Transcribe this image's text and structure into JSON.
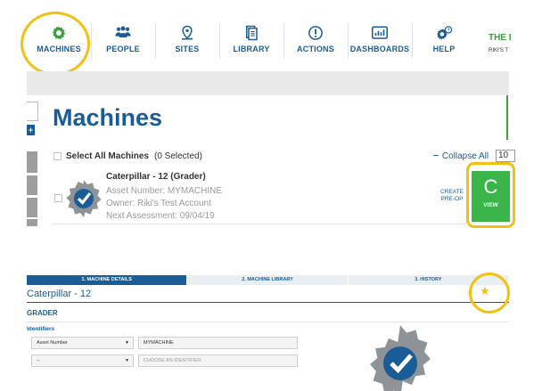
{
  "nav": {
    "items": [
      {
        "label": "MACHINES",
        "icon": "gear-icon",
        "active": true
      },
      {
        "label": "PEOPLE",
        "icon": "people-icon",
        "active": false
      },
      {
        "label": "SITES",
        "icon": "map-pin-icon",
        "active": false
      },
      {
        "label": "LIBRARY",
        "icon": "library-icon",
        "active": false
      },
      {
        "label": "ACTIONS",
        "icon": "alert-icon",
        "active": false
      },
      {
        "label": "DASHBOARDS",
        "icon": "dashboard-icon",
        "active": false
      },
      {
        "label": "HELP",
        "icon": "help-gear-icon",
        "active": false
      }
    ],
    "brand_title": "THE I",
    "brand_sub": "RIKI'S T"
  },
  "page": {
    "title": "Machines",
    "select_all_label": "Select All Machines",
    "selected_count": "(0 Selected)",
    "collapse_label": "Collapse All",
    "page_size": "10"
  },
  "machine": {
    "name": "Caterpillar - 12 (Grader)",
    "asset_number": "Asset Number: MYMACHINE",
    "owner": "Owner: Riki's Test Account",
    "next_assessment": "Next Assessment: 09/04/19",
    "create_preop": "CREATE PRE-OP",
    "view_letter": "C",
    "view_label": "VIEW"
  },
  "detail": {
    "tabs": [
      {
        "label": "1. MACHINE DETAILS",
        "active": true
      },
      {
        "label": "2. MACHINE LIBRARY",
        "active": false
      },
      {
        "label": "3. HISTORY",
        "active": false
      }
    ],
    "title": "Caterpillar - 12",
    "subtitle": "GRADER",
    "identifiers_label": "Identifiers",
    "identifier_rows": [
      {
        "type": "Asset Number",
        "value": "MYMACHINE"
      },
      {
        "type": "--",
        "value": "CHOOSE AN IDENTIFIER"
      }
    ],
    "star_icon": "star-icon"
  },
  "colors": {
    "primary": "#1a5c97",
    "accent_green": "#3bb54a",
    "highlight": "#f2c00e",
    "muted_text": "#9a9a9a"
  }
}
